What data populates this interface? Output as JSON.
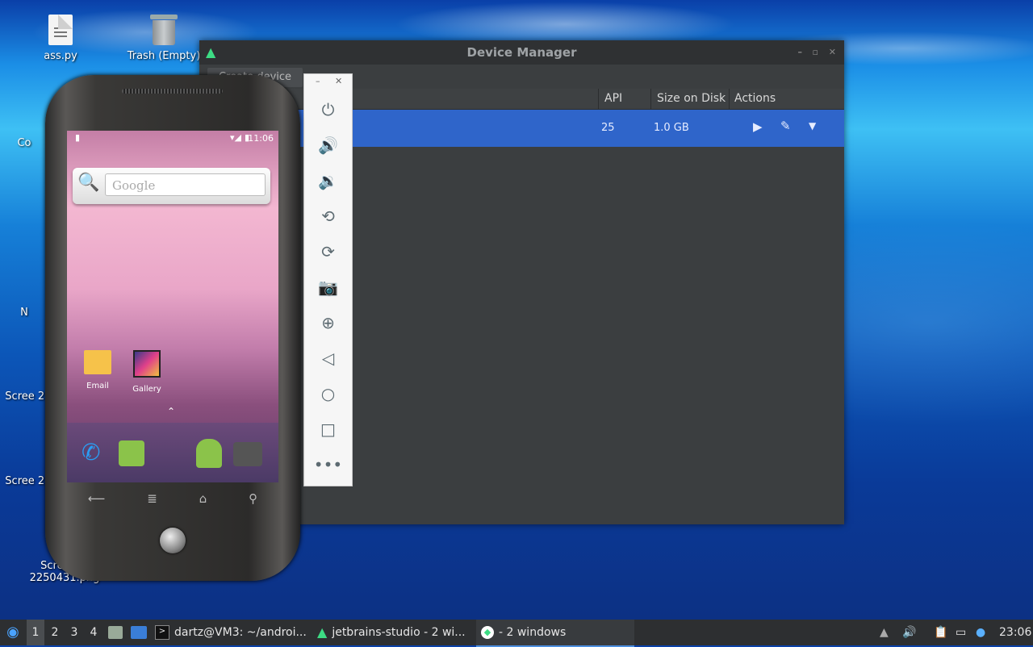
{
  "desktop": {
    "icons": [
      {
        "label": "ass.py"
      },
      {
        "label": "Trash (Empty)"
      },
      {
        "label": "Co"
      },
      {
        "label": "N"
      },
      {
        "label": "Scree 224"
      },
      {
        "label": "Scree 224"
      },
      {
        "label": "Screensh 2250431.png"
      }
    ]
  },
  "device_manager": {
    "title": "Device Manager",
    "create_button": "Create device",
    "columns": [
      "API",
      "Size on Disk",
      "Actions"
    ],
    "rows": [
      {
        "api": "25",
        "size": "1.0 GB"
      }
    ]
  },
  "emulator": {
    "toolbar": [
      "power",
      "volume-up",
      "volume-down",
      "rotate-left",
      "rotate-right",
      "screenshot",
      "zoom",
      "back",
      "home",
      "overview",
      "more"
    ],
    "status_time": "11:06",
    "search_placeholder": "Google",
    "apps": [
      {
        "label": "Email"
      },
      {
        "label": "Gallery"
      }
    ]
  },
  "taskbar": {
    "workspaces": [
      "1",
      "2",
      "3",
      "4"
    ],
    "tasks": [
      {
        "label": "dartz@VM3: ~/androi..."
      },
      {
        "label": "jetbrains-studio - 2 wi..."
      },
      {
        "label": "- 2 windows"
      }
    ],
    "clock": "23:06"
  },
  "colors": {
    "accent": "#2f65ca",
    "taskbar": "#2d2f31"
  }
}
